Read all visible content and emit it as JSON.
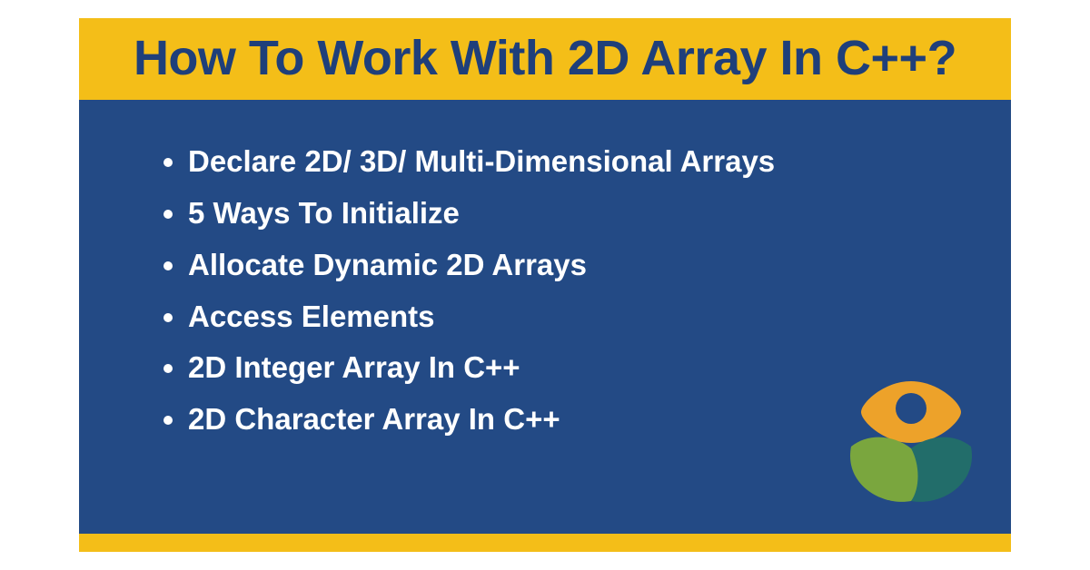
{
  "title": "How To Work With 2D Array In C++?",
  "topics": [
    "Declare 2D/ 3D/ Multi-Dimensional Arrays",
    "5 Ways To Initialize",
    "Allocate Dynamic 2D Arrays",
    "Access Elements",
    "2D Integer Array In C++",
    "2D Character Array In C++"
  ],
  "colors": {
    "accent_yellow": "#f4be18",
    "accent_blue": "#234a85",
    "title_text": "#1f3f7a",
    "body_text": "#ffffff",
    "logo_orange": "#eda22a",
    "logo_dot": "#234a85",
    "logo_leaf_green": "#7aa63e",
    "logo_leaf_teal": "#226d6a"
  }
}
